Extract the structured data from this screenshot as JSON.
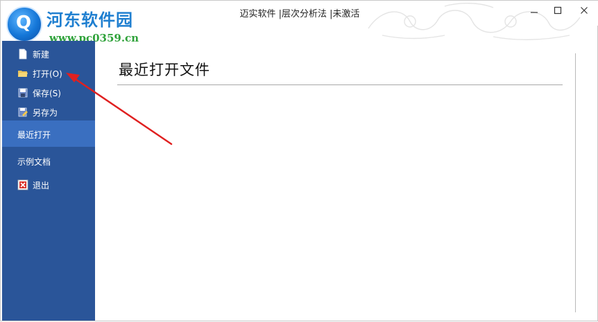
{
  "window": {
    "title": "迈实软件 |层次分析法 |未激活"
  },
  "watermark": {
    "brand": "河东软件园",
    "url": "www.pc0359.cn"
  },
  "sidebar": {
    "items": [
      {
        "label": "新建",
        "icon": "new-file-icon"
      },
      {
        "label": "打开(O)",
        "icon": "open-folder-icon"
      },
      {
        "label": "保存(S)",
        "icon": "save-icon"
      },
      {
        "label": "另存为",
        "icon": "save-as-icon"
      },
      {
        "label": "最近打开"
      },
      {
        "label": "示例文档"
      },
      {
        "label": "退出",
        "icon": "exit-icon"
      }
    ]
  },
  "main": {
    "title": "最近打开文件"
  },
  "colors": {
    "sidebar_bg": "#2a5599",
    "sidebar_selected_bg": "#3a6fc0",
    "annotation_arrow": "#e02020"
  }
}
